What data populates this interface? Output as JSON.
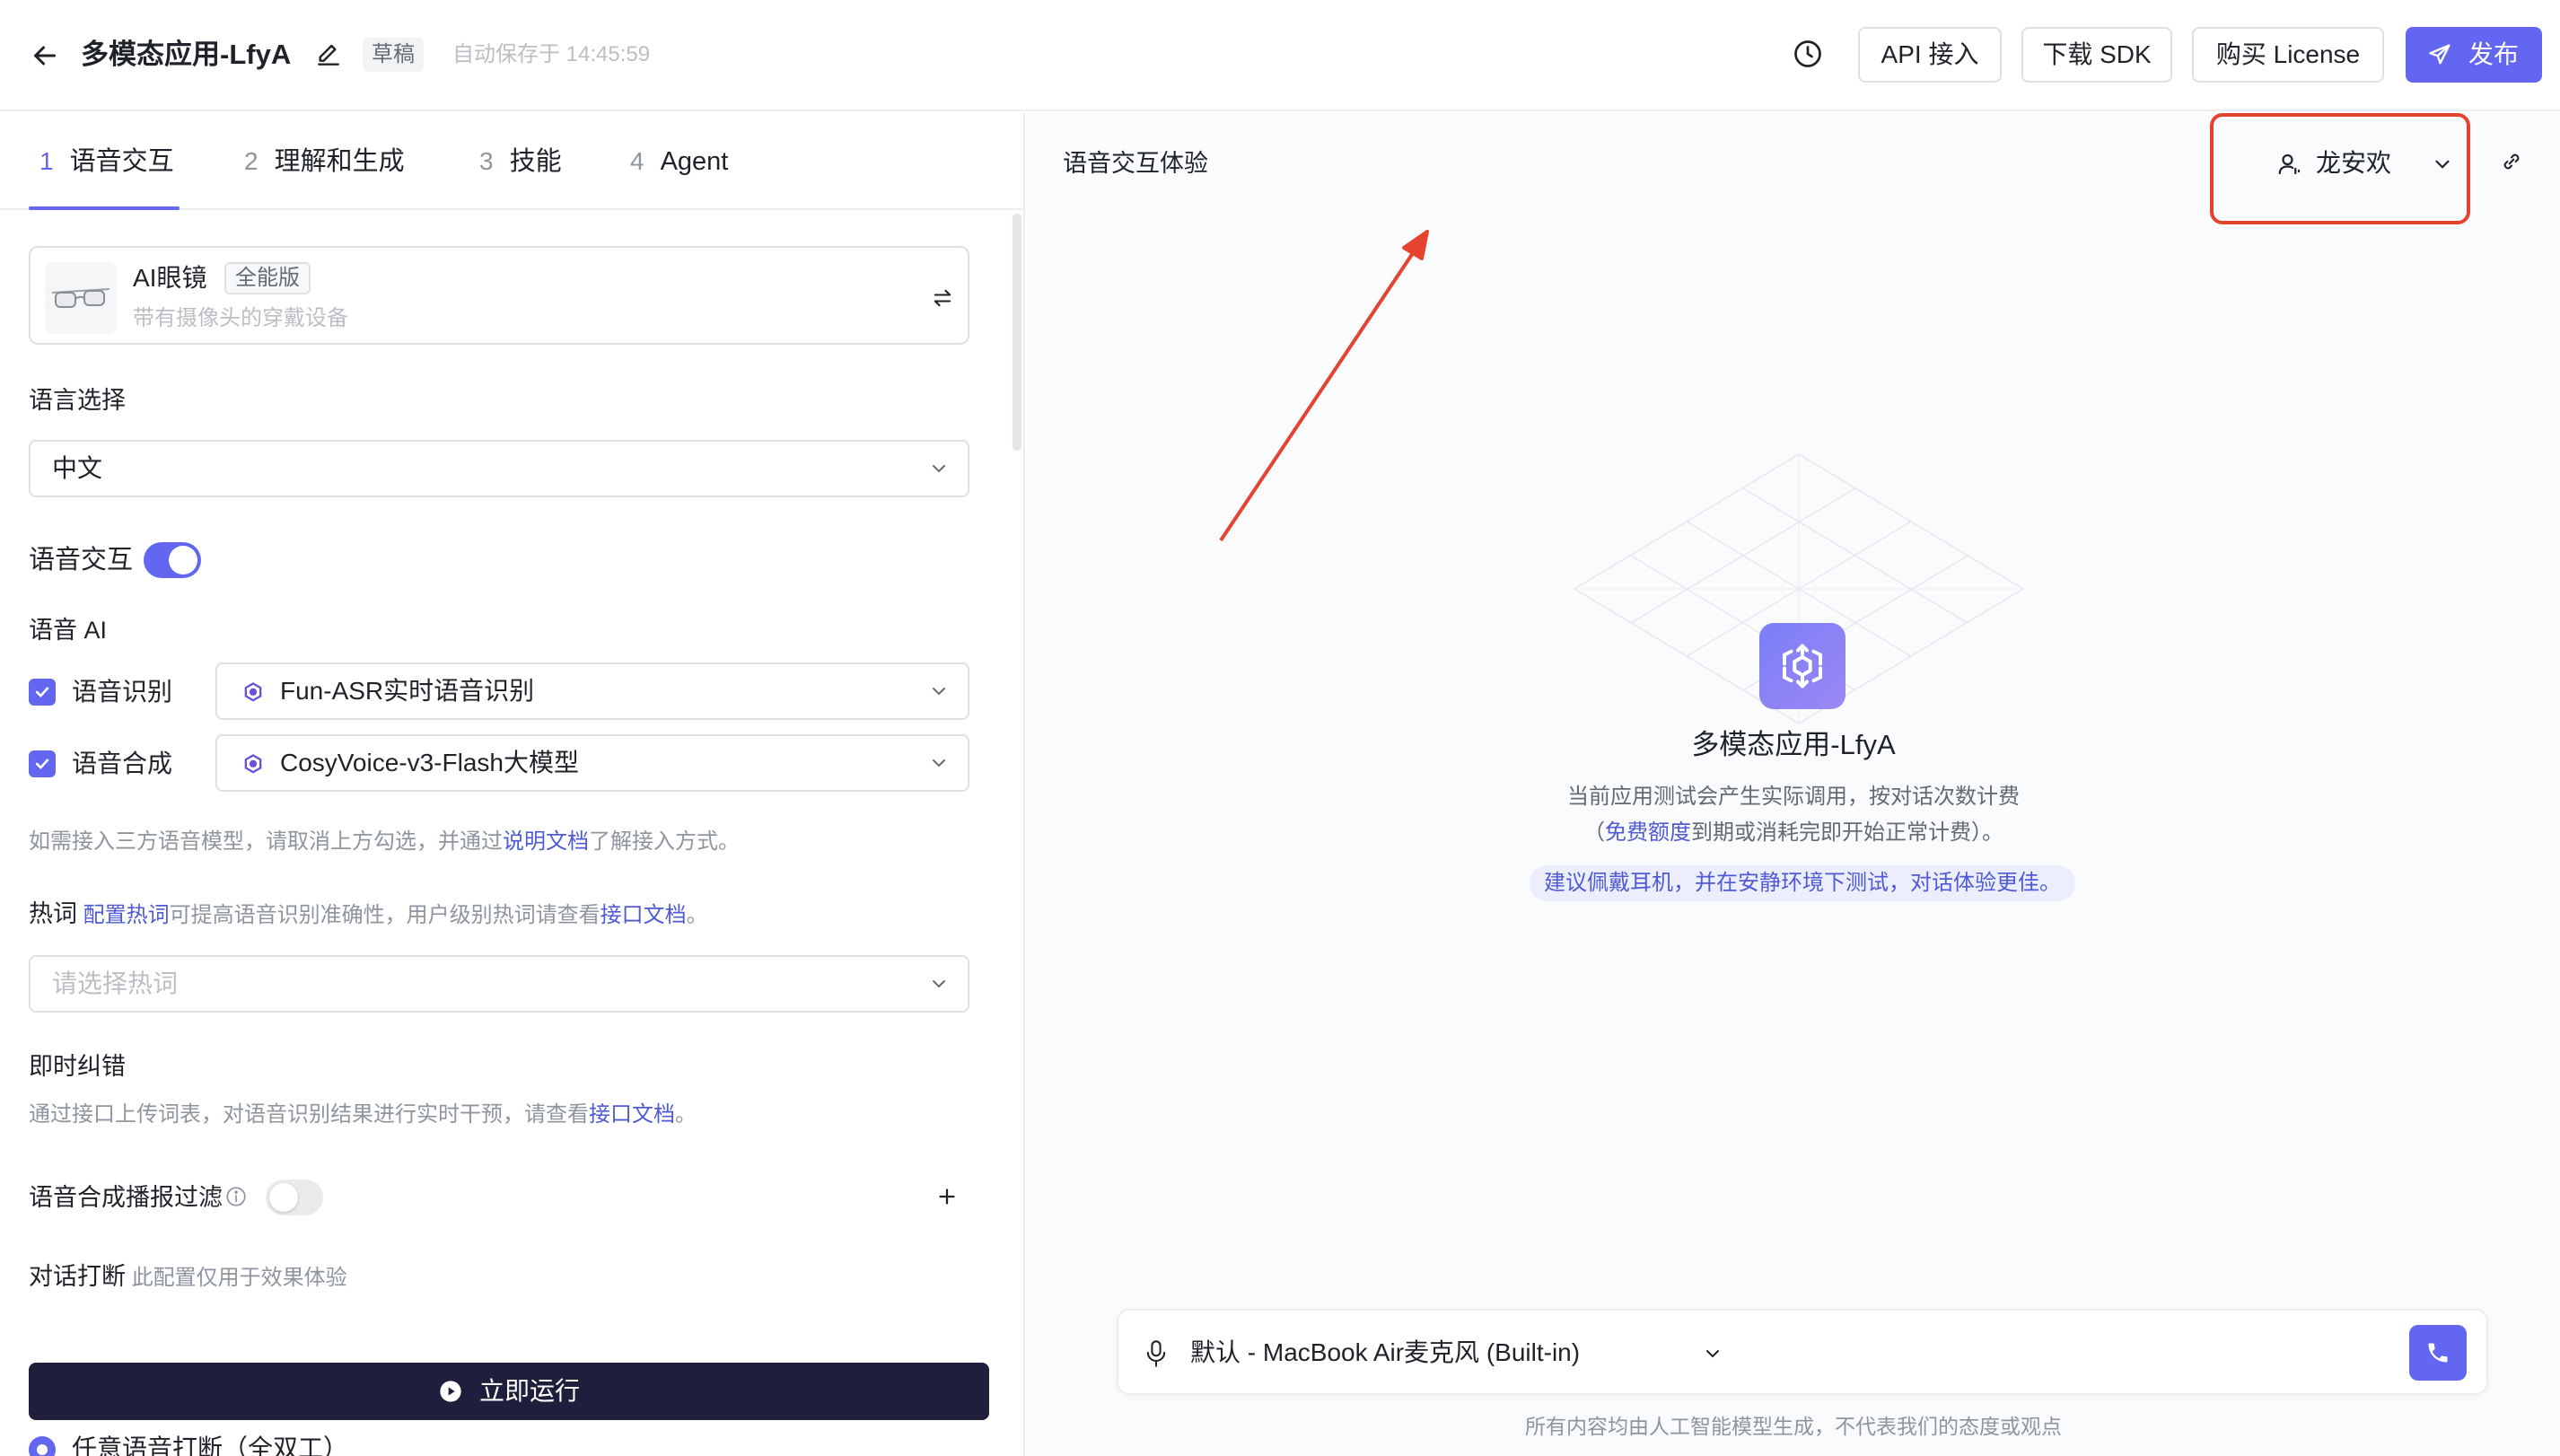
{
  "header": {
    "app_title": "多模态应用-LfyA",
    "draft_badge": "草稿",
    "autosave": "自动保存于 14:45:59",
    "api_button": "API 接入",
    "sdk_button": "下载 SDK",
    "license_button": "购买 License",
    "publish_button": "发布"
  },
  "tabs": [
    {
      "num": "1",
      "label": "语音交互"
    },
    {
      "num": "2",
      "label": "理解和生成"
    },
    {
      "num": "3",
      "label": "技能"
    },
    {
      "num": "4",
      "label": "Agent"
    }
  ],
  "device": {
    "name": "AI眼镜",
    "badge": "全能版",
    "desc": "带有摄像头的穿戴设备"
  },
  "language": {
    "label": "语言选择",
    "value": "中文"
  },
  "voice_interaction": {
    "label": "语音交互",
    "enabled": true
  },
  "voice_ai": {
    "label": "语音 AI",
    "asr": {
      "label": "语音识别",
      "checked": true,
      "model": "Fun-ASR实时语音识别"
    },
    "tts": {
      "label": "语音合成",
      "checked": true,
      "model": "CosyVoice-v3-Flash大模型"
    },
    "help_prefix": "如需接入三方语音模型，请取消上方勾选，并通过",
    "help_link": "说明文档",
    "help_suffix": "了解接入方式。"
  },
  "hotwords": {
    "label": "热词",
    "link1": "配置热词",
    "mid": "可提高语音识别准确性，用户级别热词请查看",
    "link2": "接口文档",
    "end": "。",
    "placeholder": "请选择热词"
  },
  "correction": {
    "label": "即时纠错",
    "desc_prefix": "通过接口上传词表，对语音识别结果进行实时干预，请查看",
    "desc_link": "接口文档",
    "desc_suffix": "。"
  },
  "tts_filter": {
    "label": "语音合成播报过滤",
    "enabled": false
  },
  "interrupt": {
    "label": "对话打断",
    "note": "此配置仅用于效果体验",
    "option": "任意语音打断（全双工）"
  },
  "run_button": "立即运行",
  "right": {
    "title": "语音交互体验",
    "voice_name": "龙安欢",
    "center_title": "多模态应用-LfyA",
    "line1": "当前应用测试会产生实际调用，按对话次数计费",
    "line2_prefix": "（",
    "line2_link": "免费额度",
    "line2_suffix": "到期或消耗完即开始正常计费）。",
    "tip": "建议佩戴耳机，并在安静环境下测试，对话体验更佳。",
    "mic_label": "默认 - MacBook Air麦克风 (Built-in)",
    "disclaimer": "所有内容均由人工智能模型生成，不代表我们的态度或观点"
  },
  "colors": {
    "accent": "#6366f1",
    "run_button": "#1f1f3d",
    "annotation_red": "#e5432f"
  }
}
